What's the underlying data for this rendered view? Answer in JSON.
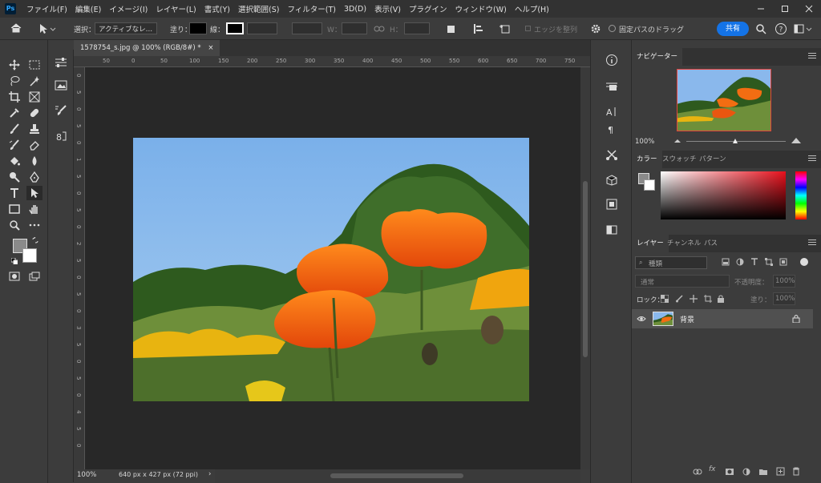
{
  "app": {
    "logo": "Ps"
  },
  "menu": [
    "ファイル(F)",
    "編集(E)",
    "イメージ(I)",
    "レイヤー(L)",
    "書式(Y)",
    "選択範囲(S)",
    "フィルター(T)",
    "3D(D)",
    "表示(V)",
    "プラグイン",
    "ウィンドウ(W)",
    "ヘルプ(H)"
  ],
  "options": {
    "select_label": "選択：",
    "select_value": "アクティブなレ…",
    "fill_label": "塗り：",
    "stroke_label": "線：",
    "w_label": "W：",
    "h_label": "H：",
    "align_edges": "エッジを整列",
    "fixed_path": "固定パスのドラッグ",
    "share": "共有"
  },
  "document": {
    "tab_title": "1578754_s.jpg @ 100% (RGB/8#) *",
    "zoom": "100%",
    "size_info": "640 px x 427 px (72 ppi)",
    "ruler_h": [
      "50",
      "0",
      "50",
      "100",
      "150",
      "200",
      "250",
      "300",
      "350",
      "400",
      "450",
      "500",
      "550",
      "600",
      "650",
      "700",
      "750"
    ],
    "ruler_v": [
      "0",
      "5",
      "0",
      "5",
      "0",
      "1",
      "5",
      "0",
      "5",
      "0",
      "2",
      "5",
      "0",
      "5",
      "0",
      "3",
      "5",
      "0",
      "5",
      "0",
      "4",
      "5",
      "0"
    ]
  },
  "navigator": {
    "tab": "ナビゲーター",
    "zoom": "100%"
  },
  "color": {
    "tabs": [
      "カラー",
      "スウォッチ",
      "パターン"
    ]
  },
  "layers": {
    "tabs": [
      "レイヤー",
      "チャンネル",
      "パス"
    ],
    "kind_placeholder": "種類",
    "blend_mode": "通常",
    "opacity_label": "不透明度：",
    "opacity_value": "100%",
    "lock_label": "ロック：",
    "fill_label": "塗り：",
    "fill_value": "100%",
    "items": [
      {
        "name": "背景"
      }
    ]
  },
  "colors": {
    "accent": "#1473e6",
    "panel_bg": "#3c3c3c",
    "canvas_bg": "#282828",
    "nav_frame": "#e8453c"
  }
}
